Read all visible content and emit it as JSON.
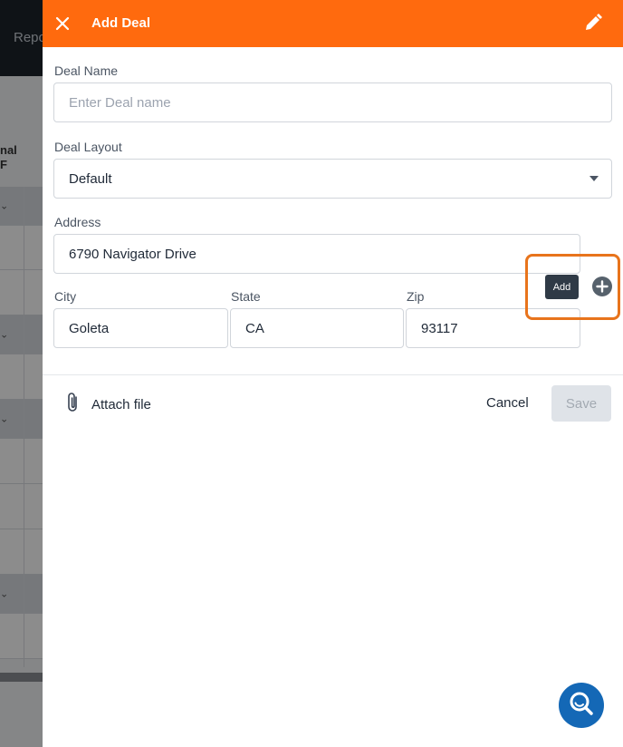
{
  "background": {
    "nav_partial": "Repo",
    "column_header_line1": "nal",
    "column_header_line2": "F",
    "chevron": "⌄"
  },
  "drawer": {
    "title": "Add Deal",
    "header_color": "#ff6a0e"
  },
  "form": {
    "deal_name": {
      "label": "Deal Name",
      "placeholder": "Enter Deal name",
      "value": ""
    },
    "deal_layout": {
      "label": "Deal Layout",
      "value": "Default"
    },
    "address": {
      "label": "Address",
      "value": "6790 Navigator Drive"
    },
    "city": {
      "label": "City",
      "value": "Goleta"
    },
    "state": {
      "label": "State",
      "value": "CA"
    },
    "zip": {
      "label": "Zip",
      "value": "93117"
    }
  },
  "add_address": {
    "tooltip": "Add"
  },
  "footer": {
    "attach_label": "Attach file",
    "cancel_label": "Cancel",
    "save_label": "Save"
  },
  "icons": {
    "close": "close-icon",
    "edit": "pencil-icon",
    "add": "plus-circle-icon",
    "attach": "paperclip-icon",
    "search": "search-icon"
  }
}
